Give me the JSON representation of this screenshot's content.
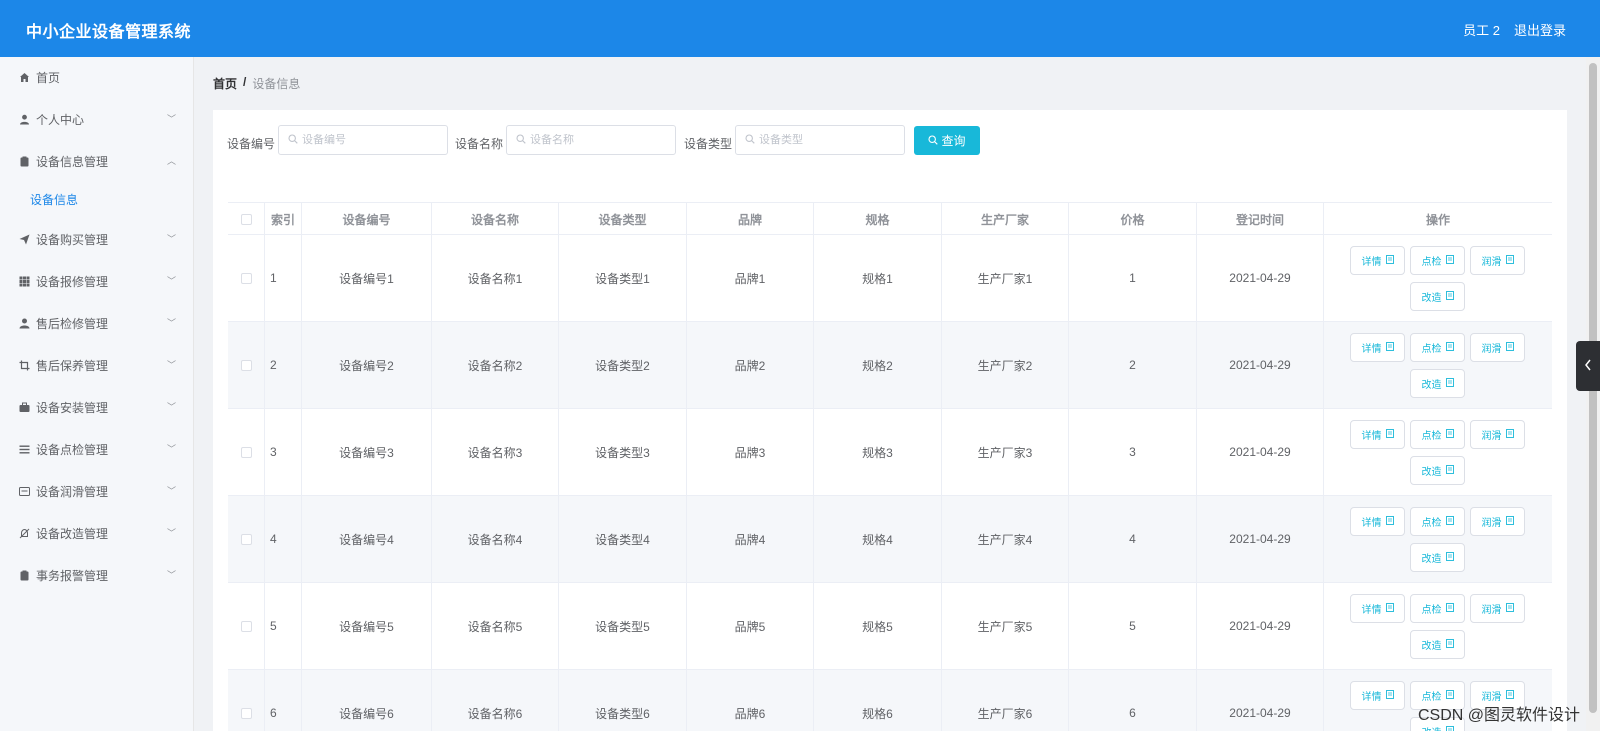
{
  "header": {
    "title": "中小企业设备管理系统",
    "user": "员工 2",
    "logout": "退出登录"
  },
  "sidebar": {
    "items": [
      {
        "label": "首页",
        "icon": "home-icon"
      },
      {
        "label": "个人中心",
        "icon": "user-icon"
      },
      {
        "label": "设备信息管理",
        "icon": "clipboard-icon"
      },
      {
        "label": "设备购买管理",
        "icon": "send-icon"
      },
      {
        "label": "设备报修管理",
        "icon": "grid-icon"
      },
      {
        "label": "售后检修管理",
        "icon": "person-icon"
      },
      {
        "label": "售后保养管理",
        "icon": "crop-icon"
      },
      {
        "label": "设备安装管理",
        "icon": "briefcase-icon"
      },
      {
        "label": "设备点检管理",
        "icon": "list-icon"
      },
      {
        "label": "设备润滑管理",
        "icon": "message-icon"
      },
      {
        "label": "设备改造管理",
        "icon": "bell-off-icon"
      },
      {
        "label": "事务报警管理",
        "icon": "clipboard-icon"
      }
    ],
    "sub_item": "设备信息"
  },
  "breadcrumb": {
    "home": "首页",
    "separator": "/",
    "current": "设备信息"
  },
  "search": {
    "fields": [
      {
        "label": "设备编号",
        "placeholder": "设备编号"
      },
      {
        "label": "设备名称",
        "placeholder": "设备名称"
      },
      {
        "label": "设备类型",
        "placeholder": "设备类型"
      }
    ],
    "button": "查询"
  },
  "table": {
    "columns": [
      "索引",
      "设备编号",
      "设备名称",
      "设备类型",
      "品牌",
      "规格",
      "生产厂家",
      "价格",
      "登记时间",
      "操作"
    ],
    "actions": [
      "详情",
      "点检",
      "润滑",
      "改造"
    ],
    "rows": [
      {
        "index": "1",
        "code": "设备编号1",
        "name": "设备名称1",
        "type": "设备类型1",
        "brand": "品牌1",
        "spec": "规格1",
        "maker": "生产厂家1",
        "price": "1",
        "date": "2021-04-29"
      },
      {
        "index": "2",
        "code": "设备编号2",
        "name": "设备名称2",
        "type": "设备类型2",
        "brand": "品牌2",
        "spec": "规格2",
        "maker": "生产厂家2",
        "price": "2",
        "date": "2021-04-29"
      },
      {
        "index": "3",
        "code": "设备编号3",
        "name": "设备名称3",
        "type": "设备类型3",
        "brand": "品牌3",
        "spec": "规格3",
        "maker": "生产厂家3",
        "price": "3",
        "date": "2021-04-29"
      },
      {
        "index": "4",
        "code": "设备编号4",
        "name": "设备名称4",
        "type": "设备类型4",
        "brand": "品牌4",
        "spec": "规格4",
        "maker": "生产厂家4",
        "price": "4",
        "date": "2021-04-29"
      },
      {
        "index": "5",
        "code": "设备编号5",
        "name": "设备名称5",
        "type": "设备类型5",
        "brand": "品牌5",
        "spec": "规格5",
        "maker": "生产厂家5",
        "price": "5",
        "date": "2021-04-29"
      },
      {
        "index": "6",
        "code": "设备编号6",
        "name": "设备名称6",
        "type": "设备类型6",
        "brand": "品牌6",
        "spec": "规格6",
        "maker": "生产厂家6",
        "price": "6",
        "date": "2021-04-29"
      }
    ]
  },
  "watermark": "CSDN @图灵软件设计",
  "colors": {
    "header_bg": "#1c87e8",
    "accent": "#18b8d9",
    "sidebar_active": "#1c87e8"
  }
}
